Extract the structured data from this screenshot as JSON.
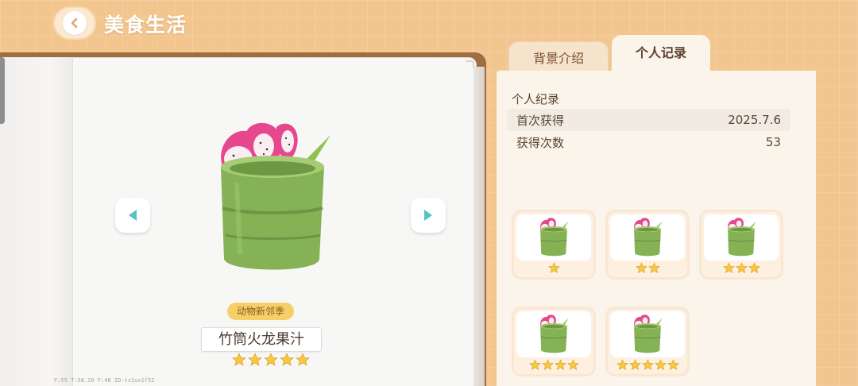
{
  "header": {
    "title": "美食生活",
    "back_icon": "chevron-left-icon"
  },
  "colors": {
    "background": "#f3c68f",
    "accent_teal": "#55c3c2",
    "star": "#f7c843",
    "tag": "#f5d068"
  },
  "food": {
    "event_tag": "动物新邻季",
    "name": "竹筒火龙果汁",
    "stars": 5
  },
  "debug": {
    "text": "F:59  T:58.20  F:48  ID:tz1ux1f52"
  },
  "tabs": [
    {
      "label": "背景介绍",
      "active": false
    },
    {
      "label": "个人记录",
      "active": true
    }
  ],
  "record": {
    "section_title": "个人纪录",
    "rows": [
      {
        "label": "首次获得",
        "value": "2025.7.6"
      },
      {
        "label": "获得次数",
        "value": "53"
      }
    ]
  },
  "variants": [
    {
      "stars": 1
    },
    {
      "stars": 2
    },
    {
      "stars": 3
    },
    {
      "stars": 4
    },
    {
      "stars": 5
    }
  ]
}
